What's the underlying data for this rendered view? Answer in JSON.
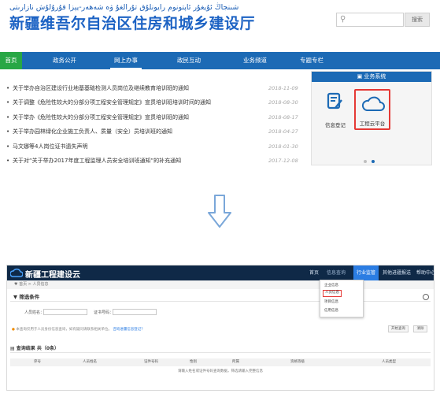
{
  "portal": {
    "uyghur_title": "شىنجاڭ ئۇيغۇر ئاپتونوم رايونلۇق تۇرالغۇ ۋە شەھەر-يېزا قۇرۇلۇش نازارىتى",
    "site_title": "新疆维吾尔自治区住房和城乡建设厅",
    "search_button": "搜索",
    "nav": [
      "首页",
      "政务公开",
      "网上办事",
      "政民互动",
      "业务频道",
      "专题专栏"
    ],
    "news": [
      {
        "title": "关于举办自治区建设行业地基基础检测人员岗位及继续教育培训班的通知",
        "date": "2018-11-09"
      },
      {
        "title": "关于调整《危险性较大的分部分项工程安全管理规定》宣贯培训班培训时间的通知",
        "date": "2018-08-30"
      },
      {
        "title": "关于举办《危险性较大的分部分项工程安全管理规定》宣贯培训班的通知",
        "date": "2018-08-17"
      },
      {
        "title": "关于举办园林绿化企业施工负责人、质量（安全）员培训班的通知",
        "date": "2018-04-27"
      },
      {
        "title": "马文娜等4人岗位证书遗失声明",
        "date": "2018-01-30"
      },
      {
        "title": "关于对“关于举办2017年度工程监理人员安全培训班通知”的补充通知",
        "date": "2017-12-08"
      }
    ],
    "biz_panel": {
      "title": "业务系统",
      "tiles": [
        {
          "label": "信息登记",
          "icon": "edit-form-icon"
        },
        {
          "label": "工程云平台",
          "icon": "cloud-icon"
        }
      ]
    }
  },
  "platform": {
    "logo_text": "新疆工程建设云",
    "nav": [
      "首页",
      "信息查询",
      "行业监管",
      "其他进疆报送",
      "帮助中心"
    ],
    "breadcrumb": "♥ 首页 > 人员信息",
    "filter_title": "▼ 筛选条件",
    "fields": [
      {
        "label": "人员姓名：",
        "value": ""
      },
      {
        "label": "证书号码：",
        "value": ""
      }
    ],
    "hint_warn": "●",
    "hint_text": "本查询仅用于人员身份信息查询，如有疑问请联系相关单位。",
    "hint_link": "咨询进疆信息登记？",
    "buttons": [
      "开始查询",
      "清除"
    ],
    "result_title": "▤ 查询结果  共（0条）",
    "columns": [
      "序号",
      "人员姓名",
      "证件号码",
      "性别",
      "所属",
      "资格等级",
      "人员类型"
    ],
    "empty_text": "请输入姓名或证件号码查询数据，筛选请输入完整信息",
    "dropdown": [
      "企业信息",
      "人员信息",
      "项目信息",
      "信用信息"
    ],
    "dropdown_selected": 1
  },
  "colors": {
    "brand_blue": "#1c6ab5",
    "active_green": "#28a745",
    "highlight_red": "#e53935",
    "platform_dark": "#0f2947"
  }
}
